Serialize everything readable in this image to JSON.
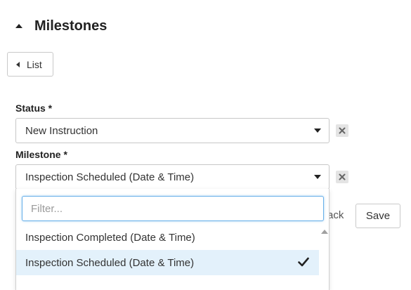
{
  "section": {
    "title": "Milestones"
  },
  "list_button": {
    "label": "List"
  },
  "status": {
    "label": "Status *",
    "value": "New Instruction"
  },
  "milestone": {
    "label": "Milestone *",
    "value": "Inspection Scheduled (Date & Time)"
  },
  "dropdown": {
    "filter_placeholder": "Filter...",
    "filter_value": "",
    "options": [
      {
        "label": "Inspection Completed (Date & Time)",
        "selected": false
      },
      {
        "label": "Inspection Scheduled (Date & Time)",
        "selected": true
      }
    ]
  },
  "actions": {
    "back_label": "ack",
    "save_label": "Save"
  },
  "colors": {
    "selected_option_bg": "#e3f1fb",
    "filter_focus_border": "#66afe9",
    "clear_button_bg": "#e4e4e4"
  }
}
